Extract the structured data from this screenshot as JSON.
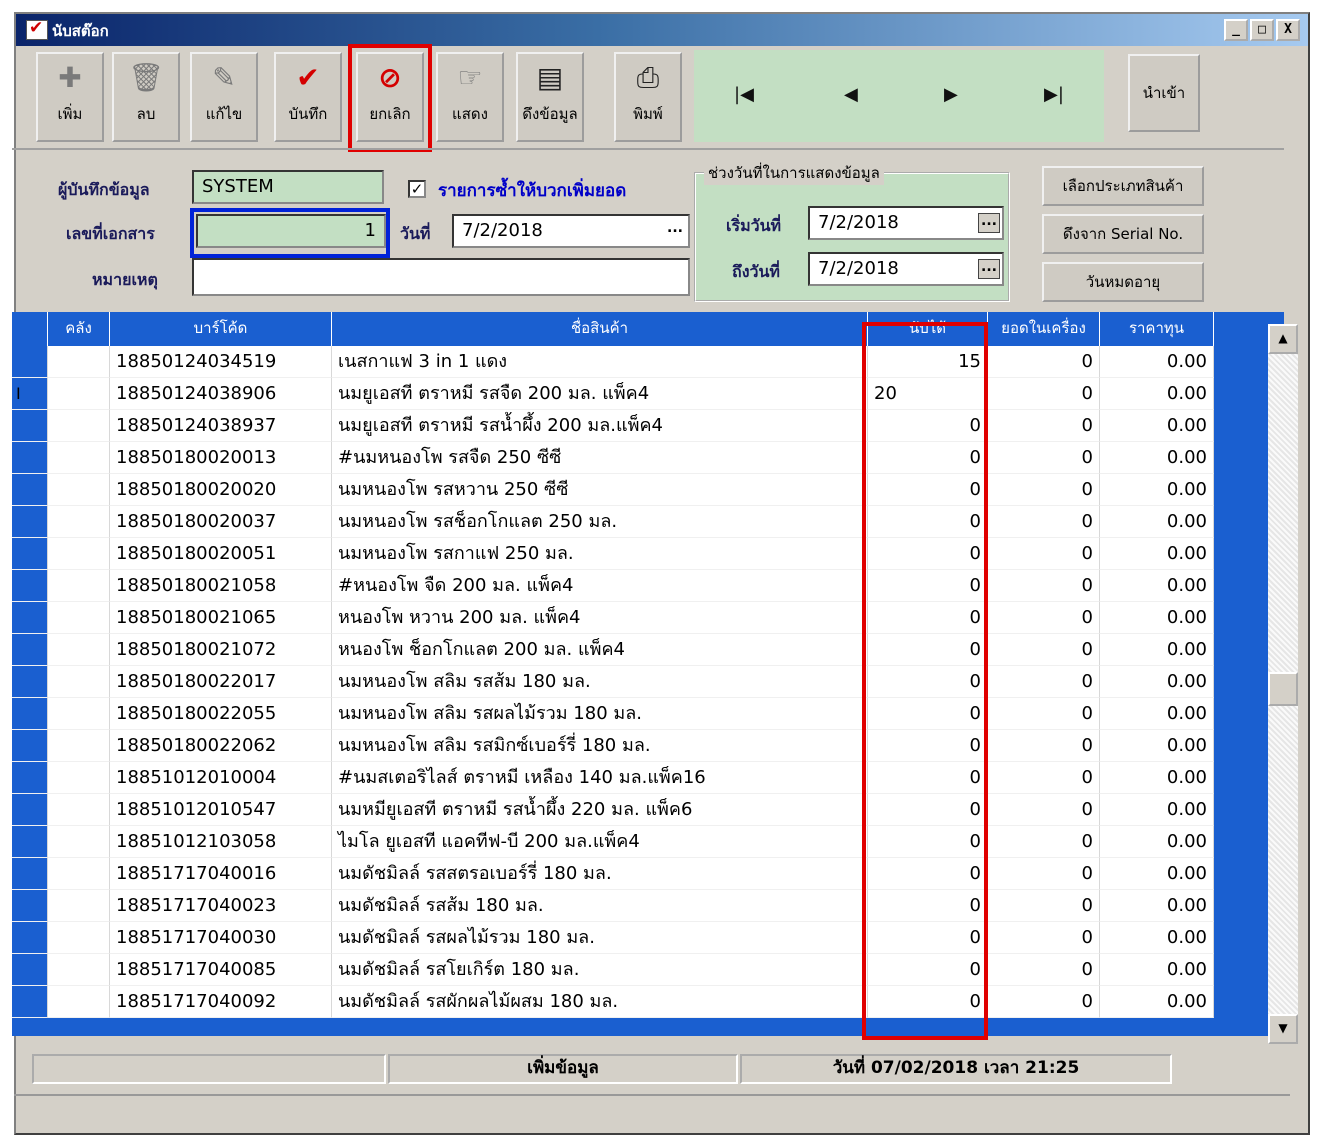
{
  "window": {
    "title": "นับสต๊อก",
    "controls": [
      "_",
      "□",
      "X"
    ]
  },
  "toolbar": {
    "buttons": [
      {
        "label": "เพิ่ม",
        "icon": "add-icon"
      },
      {
        "label": "ลบ",
        "icon": "trash-icon"
      },
      {
        "label": "แก้ไข",
        "icon": "edit-icon"
      },
      {
        "label": "บันทึก",
        "icon": "checkmark-icon"
      },
      {
        "label": "ยกเลิก",
        "icon": "cancel-icon"
      },
      {
        "label": "แสดง",
        "icon": "pointer-icon"
      },
      {
        "label": "ดึงข้อมูล",
        "icon": "pull-data-icon"
      },
      {
        "label": "พิมพ์",
        "icon": "print-icon"
      }
    ],
    "nav": {
      "first": "|◀",
      "prev": "◀",
      "next": "▶",
      "last": "▶|"
    },
    "import_label": "นำเข้า"
  },
  "form": {
    "recorder_label": "ผู้บันทึกข้อมูล",
    "recorder_value": "SYSTEM",
    "docno_label": "เลขที่เอกสาร",
    "docno_value": "1",
    "date_label": "วันที่",
    "date_value": "7/2/2018",
    "note_label": "หมายเหตุ",
    "note_value": "",
    "checkbox_label": "รายการซ้ำให้บวกเพิ่มยอด",
    "checkbox_checked": true,
    "range_title": "ช่วงวันที่ในการแสดงข้อมูล",
    "range_start_label": "เริ่มวันที่",
    "range_start_value": "7/2/2018",
    "range_end_label": "ถึงวันที่",
    "range_end_value": "7/2/2018",
    "select_type_label": "เลือกประเภทสินค้า",
    "serial_label": "ดึงจาก Serial No.",
    "expiry_label": "วันหมดอายุ"
  },
  "grid": {
    "headers": [
      "คลัง",
      "บาร์โค้ด",
      "ชื่อสินค้า",
      "นับได้",
      "ยอดในเครื่อง",
      "ราคาทุน"
    ],
    "rows": [
      {
        "barcode": "18850124034519",
        "name": "เนสกาแฟ 3 in 1 แดง",
        "counted": "15",
        "stock": "0",
        "cost": "0.00"
      },
      {
        "barcode": "18850124038906",
        "name": "นมยูเอสที ตราหมี รสจืด 200 มล. แพ็ค4",
        "counted": "20",
        "stock": "0",
        "cost": "0.00"
      },
      {
        "barcode": "18850124038937",
        "name": "นมยูเอสที ตราหมี รสน้ำผึ้ง 200 มล.แพ็ค4",
        "counted": "0",
        "stock": "0",
        "cost": "0.00"
      },
      {
        "barcode": "18850180020013",
        "name": "#นมหนองโพ รสจืด 250 ซีซี",
        "counted": "0",
        "stock": "0",
        "cost": "0.00"
      },
      {
        "barcode": "18850180020020",
        "name": "นมหนองโพ รสหวาน 250 ซีซี",
        "counted": "0",
        "stock": "0",
        "cost": "0.00"
      },
      {
        "barcode": "18850180020037",
        "name": "นมหนองโพ รสช็อกโกแลต 250 มล.",
        "counted": "0",
        "stock": "0",
        "cost": "0.00"
      },
      {
        "barcode": "18850180020051",
        "name": "นมหนองโพ รสกาแฟ 250 มล.",
        "counted": "0",
        "stock": "0",
        "cost": "0.00"
      },
      {
        "barcode": "18850180021058",
        "name": "#หนองโพ จืด 200 มล. แพ็ค4",
        "counted": "0",
        "stock": "0",
        "cost": "0.00"
      },
      {
        "barcode": "18850180021065",
        "name": "หนองโพ หวาน 200 มล. แพ็ค4",
        "counted": "0",
        "stock": "0",
        "cost": "0.00"
      },
      {
        "barcode": "18850180021072",
        "name": "หนองโพ ช็อกโกแลต 200 มล. แพ็ค4",
        "counted": "0",
        "stock": "0",
        "cost": "0.00"
      },
      {
        "barcode": "18850180022017",
        "name": "นมหนองโพ สลิม รสส้ม 180 มล.",
        "counted": "0",
        "stock": "0",
        "cost": "0.00"
      },
      {
        "barcode": "18850180022055",
        "name": "นมหนองโพ สลิม รสผลไม้รวม 180 มล.",
        "counted": "0",
        "stock": "0",
        "cost": "0.00"
      },
      {
        "barcode": "18850180022062",
        "name": "นมหนองโพ สลิม รสมิกซ์เบอร์รี่ 180 มล.",
        "counted": "0",
        "stock": "0",
        "cost": "0.00"
      },
      {
        "barcode": "18851012010004",
        "name": "#นมสเตอริไลส์ ตราหมี เหลือง 140 มล.แพ็ค16",
        "counted": "0",
        "stock": "0",
        "cost": "0.00"
      },
      {
        "barcode": "18851012010547",
        "name": "นมหมียูเอสที ตราหมี รสน้ำผึ้ง 220 มล. แพ็ค6",
        "counted": "0",
        "stock": "0",
        "cost": "0.00"
      },
      {
        "barcode": "18851012103058",
        "name": "ไมโล ยูเอสที แอคทีฟ-บี 200 มล.แพ็ค4",
        "counted": "0",
        "stock": "0",
        "cost": "0.00"
      },
      {
        "barcode": "18851717040016",
        "name": "นมดัชมิลล์ รสสตรอเบอร์รี่ 180 มล.",
        "counted": "0",
        "stock": "0",
        "cost": "0.00"
      },
      {
        "barcode": "18851717040023",
        "name": "นมดัชมิลล์ รสส้ม 180 มล.",
        "counted": "0",
        "stock": "0",
        "cost": "0.00"
      },
      {
        "barcode": "18851717040030",
        "name": "นมดัชมิลล์ รสผลไม้รวม 180 มล.",
        "counted": "0",
        "stock": "0",
        "cost": "0.00"
      },
      {
        "barcode": "18851717040085",
        "name": "นมดัชมิลล์ รสโยเกิร์ต 180 มล.",
        "counted": "0",
        "stock": "0",
        "cost": "0.00"
      },
      {
        "barcode": "18851717040092",
        "name": "นมดัชมิลล์ รสผักผลไม้ผสม 180 มล.",
        "counted": "0",
        "stock": "0",
        "cost": "0.00"
      }
    ]
  },
  "status": {
    "mode": "เพิ่มข้อมูล",
    "datetime": "วันที่ 07/02/2018 เวลา 21:25"
  },
  "colors": {
    "grid_header": "#1a5fd0",
    "panel_green": "#c3dfc3",
    "highlight_red": "#e00000",
    "highlight_blue": "#0022d8"
  }
}
